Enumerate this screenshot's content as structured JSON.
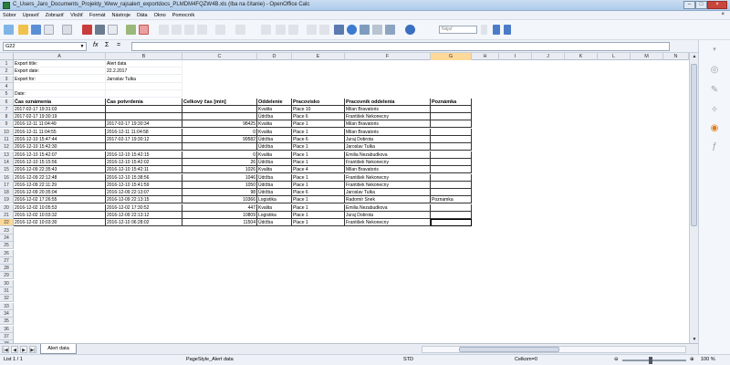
{
  "window": {
    "title": "C_Users_Jaro_Documents_Projekty_Www_rajsalert_exportdocs_PLMDM4FQZW4B.xls (Iba na čítanie) - OpenOffice Calc",
    "doc_close": "×"
  },
  "menu": [
    "Súbor",
    "Upraviť",
    "Zobraziť",
    "Vložiť",
    "Formát",
    "Nástroje",
    "Dáta",
    "Okno",
    "Pomocník"
  ],
  "toolbar": {
    "find_placeholder": "Nájsť"
  },
  "formula_bar": {
    "cell_ref": "G22",
    "fx": "fx",
    "sum": "Σ",
    "equals": "=",
    "value": ""
  },
  "columns": [
    {
      "label": "A"
    },
    {
      "label": "B"
    },
    {
      "label": "C"
    },
    {
      "label": "D"
    },
    {
      "label": "E"
    },
    {
      "label": "F"
    },
    {
      "label": "G"
    },
    {
      "label": "H"
    },
    {
      "label": "I"
    },
    {
      "label": "J"
    },
    {
      "label": "K"
    },
    {
      "label": "L"
    },
    {
      "label": "M"
    },
    {
      "label": "N"
    }
  ],
  "selected_column": "G",
  "selected_row": 22,
  "row_numbers": [
    "1",
    "2",
    "3",
    "4",
    "5",
    "6",
    "7",
    "8",
    "9",
    "10",
    "11",
    "12",
    "13",
    "14",
    "15",
    "16",
    "17",
    "18",
    "19",
    "20",
    "21",
    "22",
    "23",
    "24",
    "25",
    "26",
    "27",
    "28",
    "29",
    "30",
    "31",
    "32",
    "33",
    "34",
    "35",
    "36",
    "37",
    "38"
  ],
  "meta_rows": [
    [
      "Export title:",
      "Alert data"
    ],
    [
      "Export date:",
      "22.2.2017"
    ],
    [
      "Export for:",
      "Jaroslav Tulka"
    ],
    [
      "",
      ""
    ],
    [
      "Date:",
      ""
    ]
  ],
  "table_headers": [
    "Čas oznámenia",
    "Čas potvrdenia",
    "Celkový čas [min]",
    "Oddelenie",
    "Pracovisko",
    "Pracovník oddelenia",
    "Poznámka"
  ],
  "table_rows": [
    [
      "2017-02-17 19:31:03",
      "",
      "",
      "Kvalita",
      "Place 10",
      "Milan Bravatoris",
      ""
    ],
    [
      "2017-02-17 19:30:19",
      "",
      "",
      "Údržba",
      "Place 6",
      "František Nekonecny",
      ""
    ],
    [
      "2016-12-11 11:04:49",
      "2017-02-17 19:30:34",
      "98425",
      "Kvalita",
      "Place 1",
      "Milan Bravatoris",
      ""
    ],
    [
      "2016-12-11 11:04:55",
      "2016-12-11 11:04:58",
      "0",
      "Kvalita",
      "Place 1",
      "Milan Bravatoris",
      ""
    ],
    [
      "2016-12-10 15:47:44",
      "2017-02-17 19:30:12",
      "99582",
      "Údržba",
      "Place 6",
      "Juraj Dobrota",
      ""
    ],
    [
      "2016-12-10 15:42:30",
      "",
      "",
      "Údržba",
      "Place 1",
      "Jaroslav Tulka",
      ""
    ],
    [
      "2016-12-10 15:42:07",
      "2016-12-10 15:42:15",
      "0",
      "Kvalita",
      "Place 1",
      "Emilia Nezabudkova",
      ""
    ],
    [
      "2016-12-10 15:15:56",
      "2016-12-10 15:42:02",
      "26",
      "Údržba",
      "Place 1",
      "František Nekonecny",
      ""
    ],
    [
      "2016-12-09 22:35:43",
      "2016-12-10 15:42:11",
      "1026",
      "Kvalita",
      "Place 4",
      "Milan Bravatoris",
      ""
    ],
    [
      "2016-12-09 22:12:48",
      "2016-12-10 15:38:56",
      "1046",
      "Údržba",
      "Place 1",
      "František Nekonecny",
      ""
    ],
    [
      "2016-12-09 22:11:29",
      "2016-12-10 15:41:59",
      "1050",
      "Údržba",
      "Place 1",
      "František Nekonecny",
      ""
    ],
    [
      "2016-12-09 20:35:04",
      "2016-12-09 22:13:07",
      "98",
      "Údržba",
      "Place 6",
      "Jaroslav Tulka",
      ""
    ],
    [
      "2016-12-02 17:26:55",
      "2016-12-09 22:13:15",
      "10366",
      "Logistika",
      "Place 1",
      "Radomír Snek",
      "Poznamka"
    ],
    [
      "2016-12-02 10:05:53",
      "2016-12-02 17:30:52",
      "447",
      "Kvalita",
      "Place 1",
      "Emilia Nezabudkova",
      ""
    ],
    [
      "2016-12-02 10:03:32",
      "2016-12-09 22:13:12",
      "10809",
      "Logistika",
      "Place 1",
      "Juraj Dobrota",
      ""
    ],
    [
      "2016-12-02 10:03:30",
      "2016-12-10 06:28:02",
      "11504",
      "Údržba",
      "Place 1",
      "František Nekonecny",
      ""
    ]
  ],
  "sheet_tabs": {
    "active": "Alert data"
  },
  "status": {
    "sheet": "List 1 / 1",
    "page_style": "PageStyle_Alert data",
    "mode": "STD",
    "sum": "Celkom=0",
    "zoom": "100 %"
  }
}
